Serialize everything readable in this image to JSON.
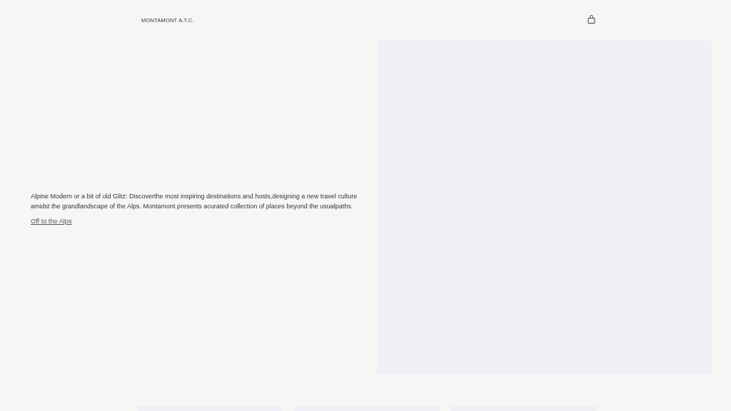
{
  "header": {
    "logo": "MONTAMONT A.T.C."
  },
  "hero": {
    "description": "Alpine Modern or a bit of old Glitz: Discoverthe most inspiring destinations and hosts,designing a new travel culture amidst the grandlandscape of the Alps. Montamont presents acurated collection of places beyond the usualpaths.",
    "link": "Off to the Alps",
    "image": {
      "kind": "placeholder"
    }
  },
  "cards": [
    {
      "kind": "placeholder"
    },
    {
      "kind": "placeholder"
    },
    {
      "kind": "placeholder"
    }
  ]
}
